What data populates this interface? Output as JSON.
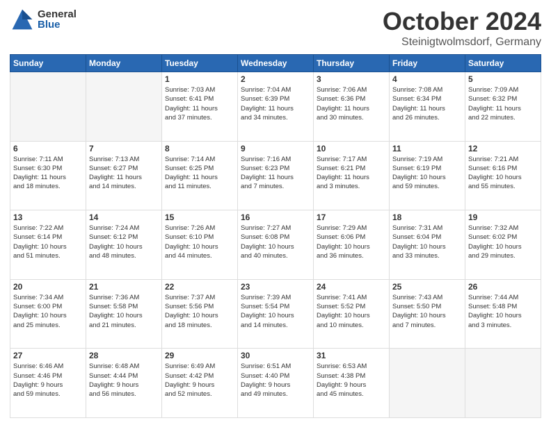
{
  "header": {
    "logo_general": "General",
    "logo_blue": "Blue",
    "month_title": "October 2024",
    "location": "Steinigtwolmsdorf, Germany"
  },
  "days_of_week": [
    "Sunday",
    "Monday",
    "Tuesday",
    "Wednesday",
    "Thursday",
    "Friday",
    "Saturday"
  ],
  "weeks": [
    [
      {
        "day": "",
        "info": ""
      },
      {
        "day": "",
        "info": ""
      },
      {
        "day": "1",
        "info": "Sunrise: 7:03 AM\nSunset: 6:41 PM\nDaylight: 11 hours\nand 37 minutes."
      },
      {
        "day": "2",
        "info": "Sunrise: 7:04 AM\nSunset: 6:39 PM\nDaylight: 11 hours\nand 34 minutes."
      },
      {
        "day": "3",
        "info": "Sunrise: 7:06 AM\nSunset: 6:36 PM\nDaylight: 11 hours\nand 30 minutes."
      },
      {
        "day": "4",
        "info": "Sunrise: 7:08 AM\nSunset: 6:34 PM\nDaylight: 11 hours\nand 26 minutes."
      },
      {
        "day": "5",
        "info": "Sunrise: 7:09 AM\nSunset: 6:32 PM\nDaylight: 11 hours\nand 22 minutes."
      }
    ],
    [
      {
        "day": "6",
        "info": "Sunrise: 7:11 AM\nSunset: 6:30 PM\nDaylight: 11 hours\nand 18 minutes."
      },
      {
        "day": "7",
        "info": "Sunrise: 7:13 AM\nSunset: 6:27 PM\nDaylight: 11 hours\nand 14 minutes."
      },
      {
        "day": "8",
        "info": "Sunrise: 7:14 AM\nSunset: 6:25 PM\nDaylight: 11 hours\nand 11 minutes."
      },
      {
        "day": "9",
        "info": "Sunrise: 7:16 AM\nSunset: 6:23 PM\nDaylight: 11 hours\nand 7 minutes."
      },
      {
        "day": "10",
        "info": "Sunrise: 7:17 AM\nSunset: 6:21 PM\nDaylight: 11 hours\nand 3 minutes."
      },
      {
        "day": "11",
        "info": "Sunrise: 7:19 AM\nSunset: 6:19 PM\nDaylight: 10 hours\nand 59 minutes."
      },
      {
        "day": "12",
        "info": "Sunrise: 7:21 AM\nSunset: 6:16 PM\nDaylight: 10 hours\nand 55 minutes."
      }
    ],
    [
      {
        "day": "13",
        "info": "Sunrise: 7:22 AM\nSunset: 6:14 PM\nDaylight: 10 hours\nand 51 minutes."
      },
      {
        "day": "14",
        "info": "Sunrise: 7:24 AM\nSunset: 6:12 PM\nDaylight: 10 hours\nand 48 minutes."
      },
      {
        "day": "15",
        "info": "Sunrise: 7:26 AM\nSunset: 6:10 PM\nDaylight: 10 hours\nand 44 minutes."
      },
      {
        "day": "16",
        "info": "Sunrise: 7:27 AM\nSunset: 6:08 PM\nDaylight: 10 hours\nand 40 minutes."
      },
      {
        "day": "17",
        "info": "Sunrise: 7:29 AM\nSunset: 6:06 PM\nDaylight: 10 hours\nand 36 minutes."
      },
      {
        "day": "18",
        "info": "Sunrise: 7:31 AM\nSunset: 6:04 PM\nDaylight: 10 hours\nand 33 minutes."
      },
      {
        "day": "19",
        "info": "Sunrise: 7:32 AM\nSunset: 6:02 PM\nDaylight: 10 hours\nand 29 minutes."
      }
    ],
    [
      {
        "day": "20",
        "info": "Sunrise: 7:34 AM\nSunset: 6:00 PM\nDaylight: 10 hours\nand 25 minutes."
      },
      {
        "day": "21",
        "info": "Sunrise: 7:36 AM\nSunset: 5:58 PM\nDaylight: 10 hours\nand 21 minutes."
      },
      {
        "day": "22",
        "info": "Sunrise: 7:37 AM\nSunset: 5:56 PM\nDaylight: 10 hours\nand 18 minutes."
      },
      {
        "day": "23",
        "info": "Sunrise: 7:39 AM\nSunset: 5:54 PM\nDaylight: 10 hours\nand 14 minutes."
      },
      {
        "day": "24",
        "info": "Sunrise: 7:41 AM\nSunset: 5:52 PM\nDaylight: 10 hours\nand 10 minutes."
      },
      {
        "day": "25",
        "info": "Sunrise: 7:43 AM\nSunset: 5:50 PM\nDaylight: 10 hours\nand 7 minutes."
      },
      {
        "day": "26",
        "info": "Sunrise: 7:44 AM\nSunset: 5:48 PM\nDaylight: 10 hours\nand 3 minutes."
      }
    ],
    [
      {
        "day": "27",
        "info": "Sunrise: 6:46 AM\nSunset: 4:46 PM\nDaylight: 9 hours\nand 59 minutes."
      },
      {
        "day": "28",
        "info": "Sunrise: 6:48 AM\nSunset: 4:44 PM\nDaylight: 9 hours\nand 56 minutes."
      },
      {
        "day": "29",
        "info": "Sunrise: 6:49 AM\nSunset: 4:42 PM\nDaylight: 9 hours\nand 52 minutes."
      },
      {
        "day": "30",
        "info": "Sunrise: 6:51 AM\nSunset: 4:40 PM\nDaylight: 9 hours\nand 49 minutes."
      },
      {
        "day": "31",
        "info": "Sunrise: 6:53 AM\nSunset: 4:38 PM\nDaylight: 9 hours\nand 45 minutes."
      },
      {
        "day": "",
        "info": ""
      },
      {
        "day": "",
        "info": ""
      }
    ]
  ]
}
